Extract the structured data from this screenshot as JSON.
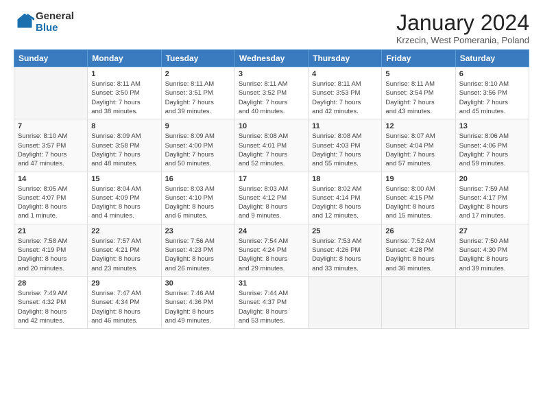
{
  "header": {
    "logo_general": "General",
    "logo_blue": "Blue",
    "month_title": "January 2024",
    "subtitle": "Krzecin, West Pomerania, Poland"
  },
  "weekdays": [
    "Sunday",
    "Monday",
    "Tuesday",
    "Wednesday",
    "Thursday",
    "Friday",
    "Saturday"
  ],
  "weeks": [
    [
      {
        "day": "",
        "info": ""
      },
      {
        "day": "1",
        "info": "Sunrise: 8:11 AM\nSunset: 3:50 PM\nDaylight: 7 hours\nand 38 minutes."
      },
      {
        "day": "2",
        "info": "Sunrise: 8:11 AM\nSunset: 3:51 PM\nDaylight: 7 hours\nand 39 minutes."
      },
      {
        "day": "3",
        "info": "Sunrise: 8:11 AM\nSunset: 3:52 PM\nDaylight: 7 hours\nand 40 minutes."
      },
      {
        "day": "4",
        "info": "Sunrise: 8:11 AM\nSunset: 3:53 PM\nDaylight: 7 hours\nand 42 minutes."
      },
      {
        "day": "5",
        "info": "Sunrise: 8:11 AM\nSunset: 3:54 PM\nDaylight: 7 hours\nand 43 minutes."
      },
      {
        "day": "6",
        "info": "Sunrise: 8:10 AM\nSunset: 3:56 PM\nDaylight: 7 hours\nand 45 minutes."
      }
    ],
    [
      {
        "day": "7",
        "info": "Sunrise: 8:10 AM\nSunset: 3:57 PM\nDaylight: 7 hours\nand 47 minutes."
      },
      {
        "day": "8",
        "info": "Sunrise: 8:09 AM\nSunset: 3:58 PM\nDaylight: 7 hours\nand 48 minutes."
      },
      {
        "day": "9",
        "info": "Sunrise: 8:09 AM\nSunset: 4:00 PM\nDaylight: 7 hours\nand 50 minutes."
      },
      {
        "day": "10",
        "info": "Sunrise: 8:08 AM\nSunset: 4:01 PM\nDaylight: 7 hours\nand 52 minutes."
      },
      {
        "day": "11",
        "info": "Sunrise: 8:08 AM\nSunset: 4:03 PM\nDaylight: 7 hours\nand 55 minutes."
      },
      {
        "day": "12",
        "info": "Sunrise: 8:07 AM\nSunset: 4:04 PM\nDaylight: 7 hours\nand 57 minutes."
      },
      {
        "day": "13",
        "info": "Sunrise: 8:06 AM\nSunset: 4:06 PM\nDaylight: 7 hours\nand 59 minutes."
      }
    ],
    [
      {
        "day": "14",
        "info": "Sunrise: 8:05 AM\nSunset: 4:07 PM\nDaylight: 8 hours\nand 1 minute."
      },
      {
        "day": "15",
        "info": "Sunrise: 8:04 AM\nSunset: 4:09 PM\nDaylight: 8 hours\nand 4 minutes."
      },
      {
        "day": "16",
        "info": "Sunrise: 8:03 AM\nSunset: 4:10 PM\nDaylight: 8 hours\nand 6 minutes."
      },
      {
        "day": "17",
        "info": "Sunrise: 8:03 AM\nSunset: 4:12 PM\nDaylight: 8 hours\nand 9 minutes."
      },
      {
        "day": "18",
        "info": "Sunrise: 8:02 AM\nSunset: 4:14 PM\nDaylight: 8 hours\nand 12 minutes."
      },
      {
        "day": "19",
        "info": "Sunrise: 8:00 AM\nSunset: 4:15 PM\nDaylight: 8 hours\nand 15 minutes."
      },
      {
        "day": "20",
        "info": "Sunrise: 7:59 AM\nSunset: 4:17 PM\nDaylight: 8 hours\nand 17 minutes."
      }
    ],
    [
      {
        "day": "21",
        "info": "Sunrise: 7:58 AM\nSunset: 4:19 PM\nDaylight: 8 hours\nand 20 minutes."
      },
      {
        "day": "22",
        "info": "Sunrise: 7:57 AM\nSunset: 4:21 PM\nDaylight: 8 hours\nand 23 minutes."
      },
      {
        "day": "23",
        "info": "Sunrise: 7:56 AM\nSunset: 4:23 PM\nDaylight: 8 hours\nand 26 minutes."
      },
      {
        "day": "24",
        "info": "Sunrise: 7:54 AM\nSunset: 4:24 PM\nDaylight: 8 hours\nand 29 minutes."
      },
      {
        "day": "25",
        "info": "Sunrise: 7:53 AM\nSunset: 4:26 PM\nDaylight: 8 hours\nand 33 minutes."
      },
      {
        "day": "26",
        "info": "Sunrise: 7:52 AM\nSunset: 4:28 PM\nDaylight: 8 hours\nand 36 minutes."
      },
      {
        "day": "27",
        "info": "Sunrise: 7:50 AM\nSunset: 4:30 PM\nDaylight: 8 hours\nand 39 minutes."
      }
    ],
    [
      {
        "day": "28",
        "info": "Sunrise: 7:49 AM\nSunset: 4:32 PM\nDaylight: 8 hours\nand 42 minutes."
      },
      {
        "day": "29",
        "info": "Sunrise: 7:47 AM\nSunset: 4:34 PM\nDaylight: 8 hours\nand 46 minutes."
      },
      {
        "day": "30",
        "info": "Sunrise: 7:46 AM\nSunset: 4:36 PM\nDaylight: 8 hours\nand 49 minutes."
      },
      {
        "day": "31",
        "info": "Sunrise: 7:44 AM\nSunset: 4:37 PM\nDaylight: 8 hours\nand 53 minutes."
      },
      {
        "day": "",
        "info": ""
      },
      {
        "day": "",
        "info": ""
      },
      {
        "day": "",
        "info": ""
      }
    ]
  ]
}
